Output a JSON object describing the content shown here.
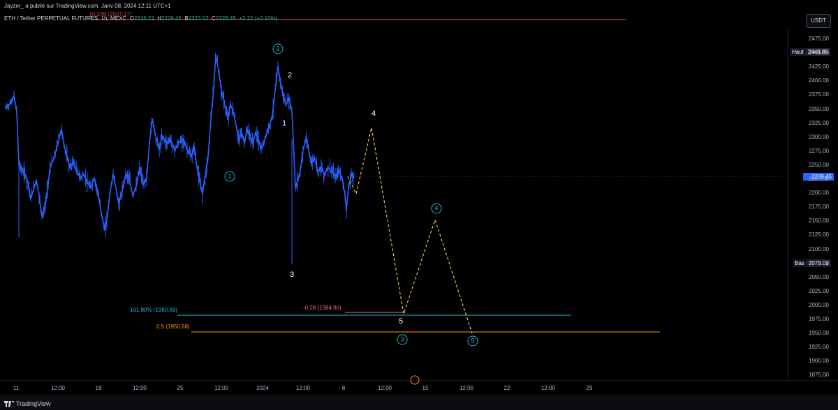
{
  "header": {
    "publisher": "Jayzer_ a publié sur TradingView.com, Janv 08, 2024 12:11 UTC+1",
    "symbol": "ETH / Tether PERPETUAL FUTURES, 1h, MEXC",
    "ohlc": [
      {
        "k": "O",
        "v": "2226.22"
      },
      {
        "k": "H",
        "v": "2228.45"
      },
      {
        "k": "B",
        "v": "2223.52"
      },
      {
        "k": "C",
        "v": "2228.45"
      }
    ],
    "change": "+2.22 (+0.10%)",
    "top_fib": "0.236 (2507.17)"
  },
  "currency_button": "USDT",
  "price_tags": {
    "high_label": "Haut",
    "high_value": "2449.85",
    "last": "2228.45",
    "low_label": "Bas",
    "low_value": "2073.01"
  },
  "y_axis": [
    "2475.00",
    "2450.00",
    "2425.00",
    "2400.00",
    "2375.00",
    "2350.00",
    "2325.00",
    "2300.00",
    "2275.00",
    "2250.00",
    "2225.00",
    "2200.00",
    "2175.00",
    "2150.00",
    "2125.00",
    "2100.00",
    "2075.00",
    "2050.00",
    "2025.00",
    "2000.00",
    "1975.00",
    "1950.00",
    "1925.00",
    "1900.00",
    "1875.00"
  ],
  "x_axis": [
    "11",
    "12:00",
    "18",
    "12:00",
    "25",
    "12:00",
    "2024",
    "12:00",
    "8",
    "12:00",
    "15",
    "12:00",
    "22",
    "12:00",
    "29"
  ],
  "fib_labels": {
    "ext_1618": "161.80% (1980.69)",
    "half": "0.5 (1950.68)",
    "neg": "-0.28 (1984.96)"
  },
  "wave_labels": {
    "plain": [
      "2",
      "1",
      "3",
      "4",
      "5"
    ],
    "circled": [
      "1",
      "2",
      "3",
      "4",
      "5"
    ]
  },
  "brand": "TradingView",
  "colors": {
    "candles": "#2962ff",
    "projection": "#f5d547",
    "fib_1618": "#22b8cf",
    "fib_half": "#ff9800",
    "fib_neg": "#f06292",
    "top_line": "#ef5350",
    "last_price": "#2962ff"
  }
}
